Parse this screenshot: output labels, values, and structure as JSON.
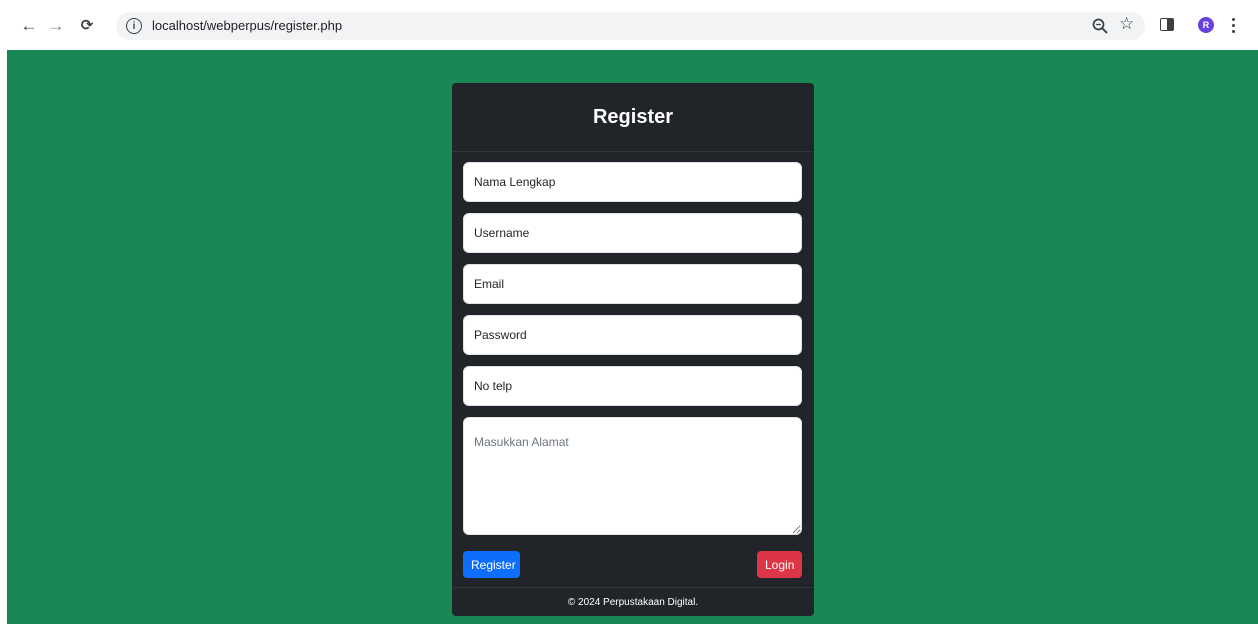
{
  "browser": {
    "url": "localhost/webperpus/register.php",
    "avatar_letter": "R"
  },
  "form": {
    "title": "Register",
    "fields": {
      "nama_lengkap": "Nama Lengkap",
      "username": "Username",
      "email": "Email",
      "password": "Password",
      "no_telp": "No telp",
      "alamat": "Masukkan Alamat"
    },
    "register_label": "Register",
    "login_label": "Login",
    "footer": "© 2024 Perpustakaan Digital."
  },
  "colors": {
    "page_background": "#1b8754",
    "card_background": "#212529",
    "register_button": "#0d6efd",
    "login_button": "#dc3545"
  }
}
